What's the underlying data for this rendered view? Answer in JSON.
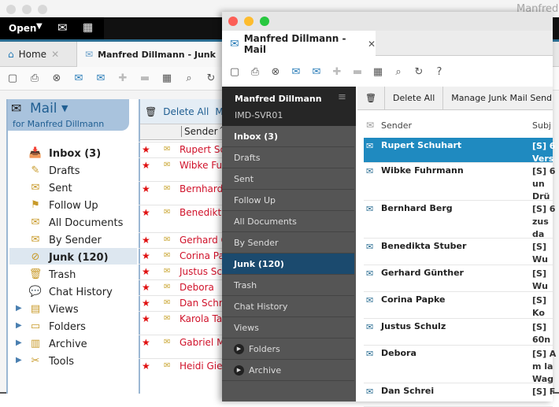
{
  "back_window": {
    "title_partial": "Manfred",
    "open_menu": "Open",
    "tabs": [
      {
        "label": "Home",
        "icon": "home-icon"
      },
      {
        "label": "Manfred Dillmann - Junk",
        "icon": "mail-icon"
      }
    ],
    "nav_title": "Mail",
    "nav_subtitle": "for Manfred Dillmann",
    "nav_items": [
      {
        "label": "Inbox (3)",
        "icon": "inbox-icon",
        "bold": true
      },
      {
        "label": "Drafts",
        "icon": "drafts-icon"
      },
      {
        "label": "Sent",
        "icon": "sent-icon"
      },
      {
        "label": "Follow Up",
        "icon": "flag-icon"
      },
      {
        "label": "All Documents",
        "icon": "documents-icon"
      },
      {
        "label": "By Sender",
        "icon": "by-sender-icon"
      },
      {
        "label": "Junk (120)",
        "icon": "junk-icon",
        "bold": true,
        "selected": true
      },
      {
        "label": "Trash",
        "icon": "trash-icon"
      },
      {
        "label": "Chat History",
        "icon": "chat-icon"
      },
      {
        "label": "Views",
        "icon": "views-icon",
        "expandable": true
      },
      {
        "label": "Folders",
        "icon": "folder-icon",
        "expandable": true
      },
      {
        "label": "Archive",
        "icon": "archive-icon",
        "expandable": true
      },
      {
        "label": "Tools",
        "icon": "tools-icon",
        "expandable": true
      }
    ],
    "action_delete_all": "Delete All",
    "action_partial": "M",
    "column_sender": "Sender",
    "senders": [
      "Rupert Sch",
      "Wibke Fuh",
      "Bernhard",
      "Benedikta",
      "Gerhard C",
      "Corina Pa",
      "Justus Sch",
      "Debora",
      "Dan Schre",
      "Karola Ta",
      "Gabriel M",
      "Heidi Gies"
    ]
  },
  "front_window": {
    "tab_label": "Manfred Dillmann - Mail",
    "account_name": "Manfred Dillmann",
    "server": "IMD-SVR01",
    "nav_items": [
      {
        "label": "Inbox (3)",
        "bold": true
      },
      {
        "label": "Drafts"
      },
      {
        "label": "Sent"
      },
      {
        "label": "Follow Up"
      },
      {
        "label": "All Documents"
      },
      {
        "label": "By Sender"
      },
      {
        "label": "Junk (120)",
        "selected": true
      },
      {
        "label": "Trash"
      },
      {
        "label": "Chat History"
      },
      {
        "label": "Views"
      },
      {
        "label": "Folders",
        "expandable": true
      },
      {
        "label": "Archive",
        "expandable": true
      }
    ],
    "action_delete_all": "Delete All",
    "action_manage": "Manage Junk Mail Send",
    "column_sender": "Sender",
    "column_subject": "Subj",
    "messages": [
      {
        "sender": "Rupert Schuhart",
        "subject": "[S] 6\nVers",
        "selected": true
      },
      {
        "sender": "Wibke Fuhrmann",
        "subject": "[S] 6\nun\nDrü"
      },
      {
        "sender": "Bernhard Berg",
        "subject": "[S] 6\nzus\nda"
      },
      {
        "sender": "Benedikta Stuber",
        "subject": "[S]\nWu"
      },
      {
        "sender": "Gerhard Günther",
        "subject": "[S]\nWu"
      },
      {
        "sender": "Corina Papke",
        "subject": "[S]\nKo"
      },
      {
        "sender": "Justus Schulz",
        "subject": "[S]\n60n"
      },
      {
        "sender": "Debora",
        "subject": "[S] A\nm la\nWag"
      },
      {
        "sender": "Dan Schrei",
        "subject": "[S] F"
      }
    ]
  },
  "colors": {
    "accent": "#1f8ac0",
    "junk_sender": "#d0122a",
    "dark_nav": "#555555",
    "selected_nav": "#1b4a6e"
  }
}
